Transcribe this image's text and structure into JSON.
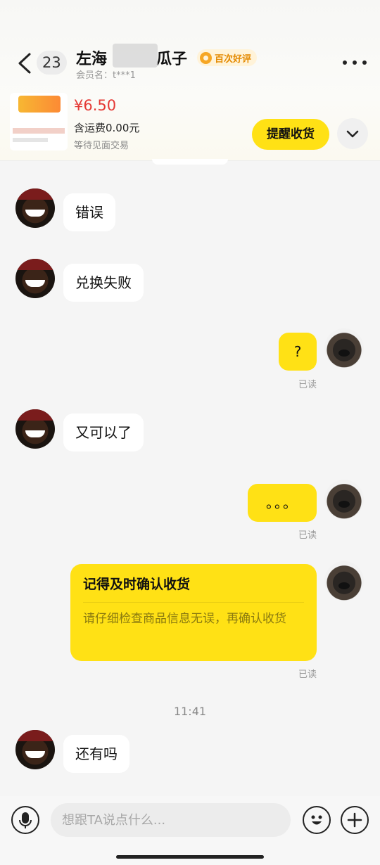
{
  "header": {
    "unread_count": "23",
    "title": "左海",
    "title_suffix": "瓜子",
    "badge": "百次好评",
    "member": "会员名：t***1"
  },
  "product": {
    "price": "¥6.50",
    "shipping": "含运费0.00元",
    "status": "等待见面交易",
    "remind_button": "提醒收货"
  },
  "messages": [
    {
      "from": "other",
      "text": "错误"
    },
    {
      "from": "other",
      "text": "兑换失败"
    },
    {
      "from": "me",
      "text": "?",
      "status": "已读"
    },
    {
      "from": "other",
      "text": "又可以了"
    },
    {
      "from": "me",
      "text": "。。。",
      "status": "已读"
    },
    {
      "from": "me",
      "card_title": "记得及时确认收货",
      "card_body": "请仔细检查商品信息无误，再确认收货",
      "status": "已读"
    },
    {
      "from": "other",
      "text": "还有吗"
    }
  ],
  "timestamp": "11:41",
  "composer": {
    "placeholder": "想跟TA说点什么..."
  },
  "icons": {
    "back": "chevron-left-icon",
    "more": "more-dots-icon",
    "expand": "chevron-down-icon",
    "voice": "microphone-icon",
    "emoji": "smile-icon",
    "add": "plus-icon",
    "badge": "medal-icon"
  },
  "colors": {
    "accent_yellow": "#ffe115",
    "price_red": "#e53935",
    "badge_orange": "#e48a00"
  }
}
